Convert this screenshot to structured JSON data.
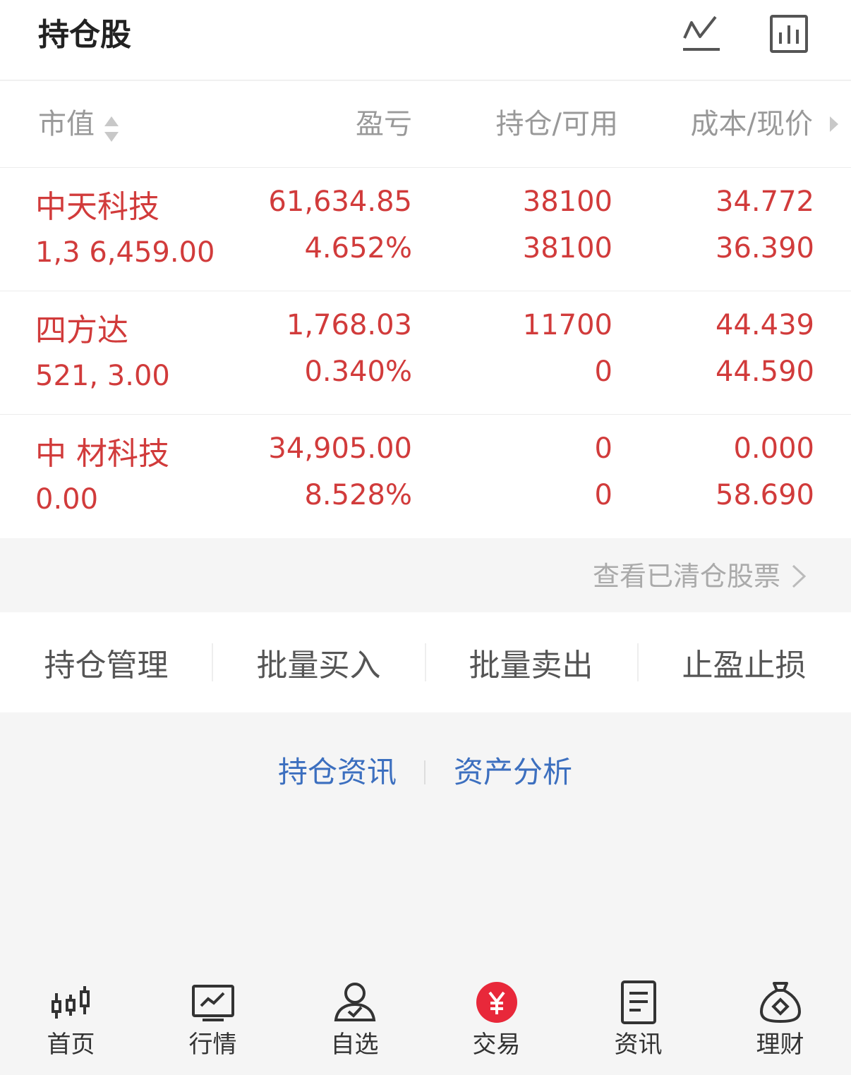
{
  "header": {
    "title": "持仓股",
    "icons": [
      "trend-line-icon",
      "bar-chart-icon"
    ]
  },
  "columns": {
    "market_value": "市值",
    "profit_loss": "盈亏",
    "holding_available": "持仓/可用",
    "cost_price": "成本/现价"
  },
  "positions": [
    {
      "name": "中天科技",
      "market_value": "1,3 6,459.00",
      "profit": "61,634.85",
      "profit_pct": "4.652%",
      "holding": "38100",
      "available": "38100",
      "cost": "34.772",
      "price": "36.390"
    },
    {
      "name": "四方达",
      "market_value": "521, 3.00",
      "profit": "1,768.03",
      "profit_pct": "0.340%",
      "holding": "11700",
      "available": "0",
      "cost": "44.439",
      "price": "44.590"
    },
    {
      "name": "中 材科技",
      "market_value": "0.00",
      "profit": "34,905.00",
      "profit_pct": "8.528%",
      "holding": "0",
      "available": "0",
      "cost": "0.000",
      "price": "58.690"
    }
  ],
  "cleared_link": "查看已清仓股票",
  "actions": [
    "持仓管理",
    "批量买入",
    "批量卖出",
    "止盈止损"
  ],
  "links": [
    "持仓资讯",
    "资产分析"
  ],
  "tabs": [
    {
      "label": "首页",
      "icon": "candlestick-icon"
    },
    {
      "label": "行情",
      "icon": "market-chart-icon"
    },
    {
      "label": "自选",
      "icon": "watchlist-user-icon"
    },
    {
      "label": "交易",
      "icon": "yuan-trade-icon"
    },
    {
      "label": "资讯",
      "icon": "news-document-icon"
    },
    {
      "label": "理财",
      "icon": "money-bag-icon"
    }
  ],
  "colors": {
    "profit_red": "#d13b3b",
    "link_blue": "#3c6fbf",
    "trade_red": "#e8283a"
  }
}
